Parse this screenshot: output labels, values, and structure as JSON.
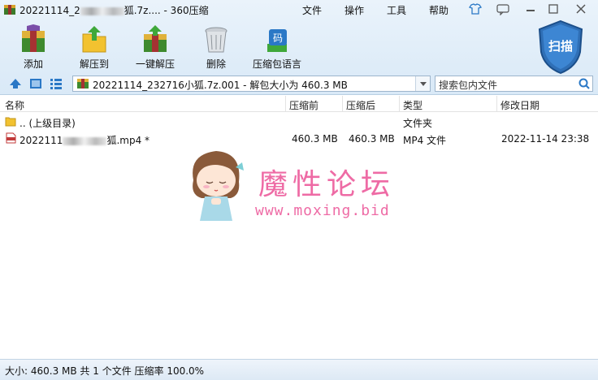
{
  "window": {
    "title": "20221114_2        狐.7z.... - 360压缩",
    "title_prefix": "20221114_2",
    "title_suffix": "狐.7z.... - 360压缩"
  },
  "menu": [
    "文件",
    "操作",
    "工具",
    "帮助"
  ],
  "toolbar": [
    {
      "label": "添加",
      "icon": "add-archive-icon"
    },
    {
      "label": "解压到",
      "icon": "extract-to-icon"
    },
    {
      "label": "一键解压",
      "icon": "one-click-extract-icon"
    },
    {
      "label": "删除",
      "icon": "trash-icon"
    },
    {
      "label": "压缩包语言",
      "icon": "archive-language-icon",
      "badge": "码"
    }
  ],
  "scan_button": "扫描",
  "address": {
    "path": "20221114_232716小狐.7z.001 - 解包大小为 460.3 MB",
    "search_placeholder": "搜索包内文件"
  },
  "columns": [
    "名称",
    "压缩前",
    "压缩后",
    "类型",
    "修改日期"
  ],
  "rows": [
    {
      "name": ".. (上级目录)",
      "before": "",
      "after": "",
      "type": "文件夹",
      "date": "",
      "icon": "folder-icon"
    },
    {
      "name_prefix": "2022111",
      "name_suffix": "狐.mp4 *",
      "before": "460.3 MB",
      "after": "460.3 MB",
      "type": "MP4 文件",
      "date": "2022-11-14 23:38",
      "icon": "mp4-file-icon"
    }
  ],
  "watermark": {
    "title": "魔性论坛",
    "url": "www.moxing.bid"
  },
  "status": "大小: 460.3 MB 共 1 个文件 压缩率 100.0%",
  "colors": {
    "accent": "#2a78c6",
    "watermark": "#ee6ba5",
    "shield": "#2f6fb6"
  }
}
